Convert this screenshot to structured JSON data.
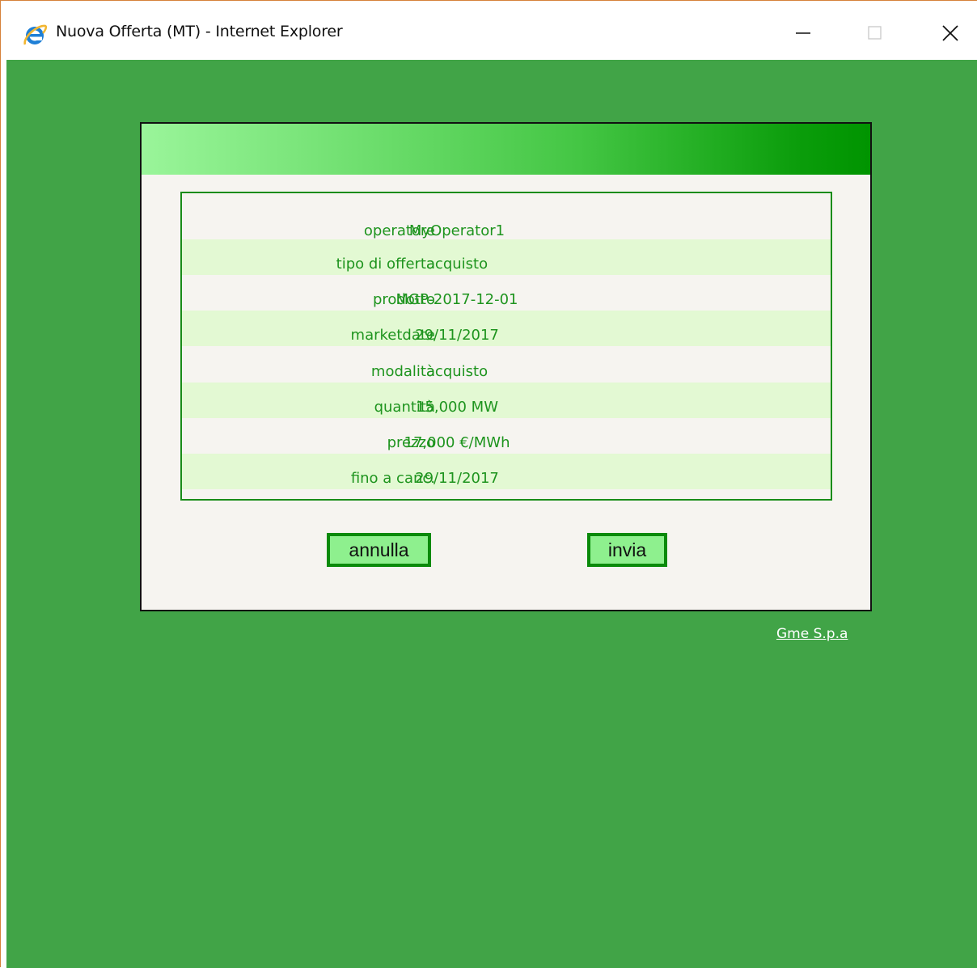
{
  "window": {
    "title": "Nuova Offerta (MT) - Internet Explorer",
    "app_icon": "internet-explorer-icon",
    "controls": [
      "minimize-icon",
      "maximize-icon",
      "close-icon"
    ]
  },
  "colors": {
    "page_background": "#41a447",
    "panel_background": "#f6f4f0",
    "text_green": "#1e941e",
    "row_alt": "#e3f9d3",
    "button_fill": "#8ef08e",
    "button_border": "#0a8a0a"
  },
  "offer": {
    "rows": [
      {
        "label": "operatore",
        "value": "MyOperator1"
      },
      {
        "label": "tipo di offerta",
        "value": "acquisto"
      },
      {
        "label": "prodotto",
        "value": "MGP-2017-12-01"
      },
      {
        "label": "marketdate",
        "value": "29/11/2017"
      },
      {
        "label": "modalità",
        "value": "acquisto"
      },
      {
        "label": "quantità",
        "value": "15,000 MW"
      },
      {
        "label": "prezzo",
        "value": "17,000 €/MWh"
      },
      {
        "label": "fino a canc.",
        "value": "29/11/2017"
      }
    ]
  },
  "actions": {
    "cancel_label": "annulla",
    "submit_label": "invia"
  },
  "footer": {
    "link_text": "Gme S.p.a"
  }
}
